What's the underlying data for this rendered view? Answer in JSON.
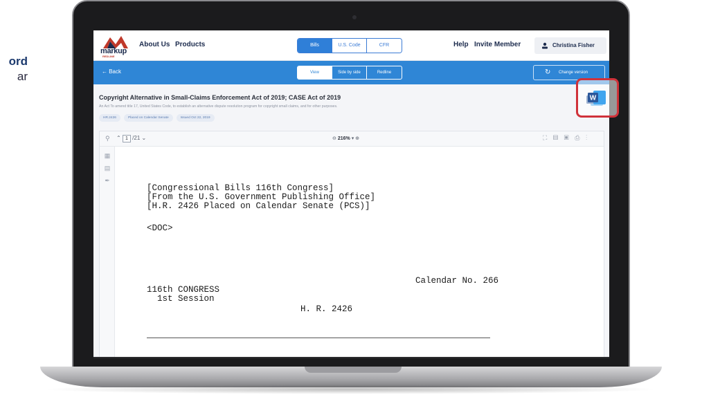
{
  "side_caption": {
    "line1": "",
    "line2": "ord",
    "line3": "ar"
  },
  "nav": {
    "logo_text": "markup",
    "logo_sub": "REDLINE",
    "about": "About Us",
    "products": "Products",
    "tabs": [
      "Bills",
      "U.S. Code",
      "CFR"
    ],
    "help": "Help",
    "invite": "Invite Member",
    "user": "Christina Fisher"
  },
  "bar": {
    "back": "← Back",
    "view_tabs": [
      "View",
      "Side by side",
      "Redline"
    ],
    "change_version": "Change version"
  },
  "bill": {
    "title": "Copyright Alternative in Small-Claims Enforcement Act of 2019; CASE Act of 2019",
    "description": "An Act To amend title 17, United States Code, to establish an alternative dispute resolution program for copyright small claims, and for other purposes.",
    "tags": [
      "HR.2426",
      "Placed on Calendar Senate",
      "Issued Oct 22, 2019"
    ]
  },
  "viewer": {
    "page_current": "1",
    "page_total": "/21",
    "zoom": "216%",
    "zoom_caret": "▾"
  },
  "document": {
    "lines": [
      "[Congressional Bills 116th Congress]",
      "[From the U.S. Government Publishing Office]",
      "[H.R. 2426 Placed on Calendar Senate (PCS)]",
      "<DOC>",
      "Calendar No. 266",
      "116th CONGRESS",
      "  1st Session",
      "H. R. 2426"
    ]
  },
  "colors": {
    "accent": "#2f86d6",
    "highlight": "#d0323a",
    "word": "#2b579a"
  }
}
